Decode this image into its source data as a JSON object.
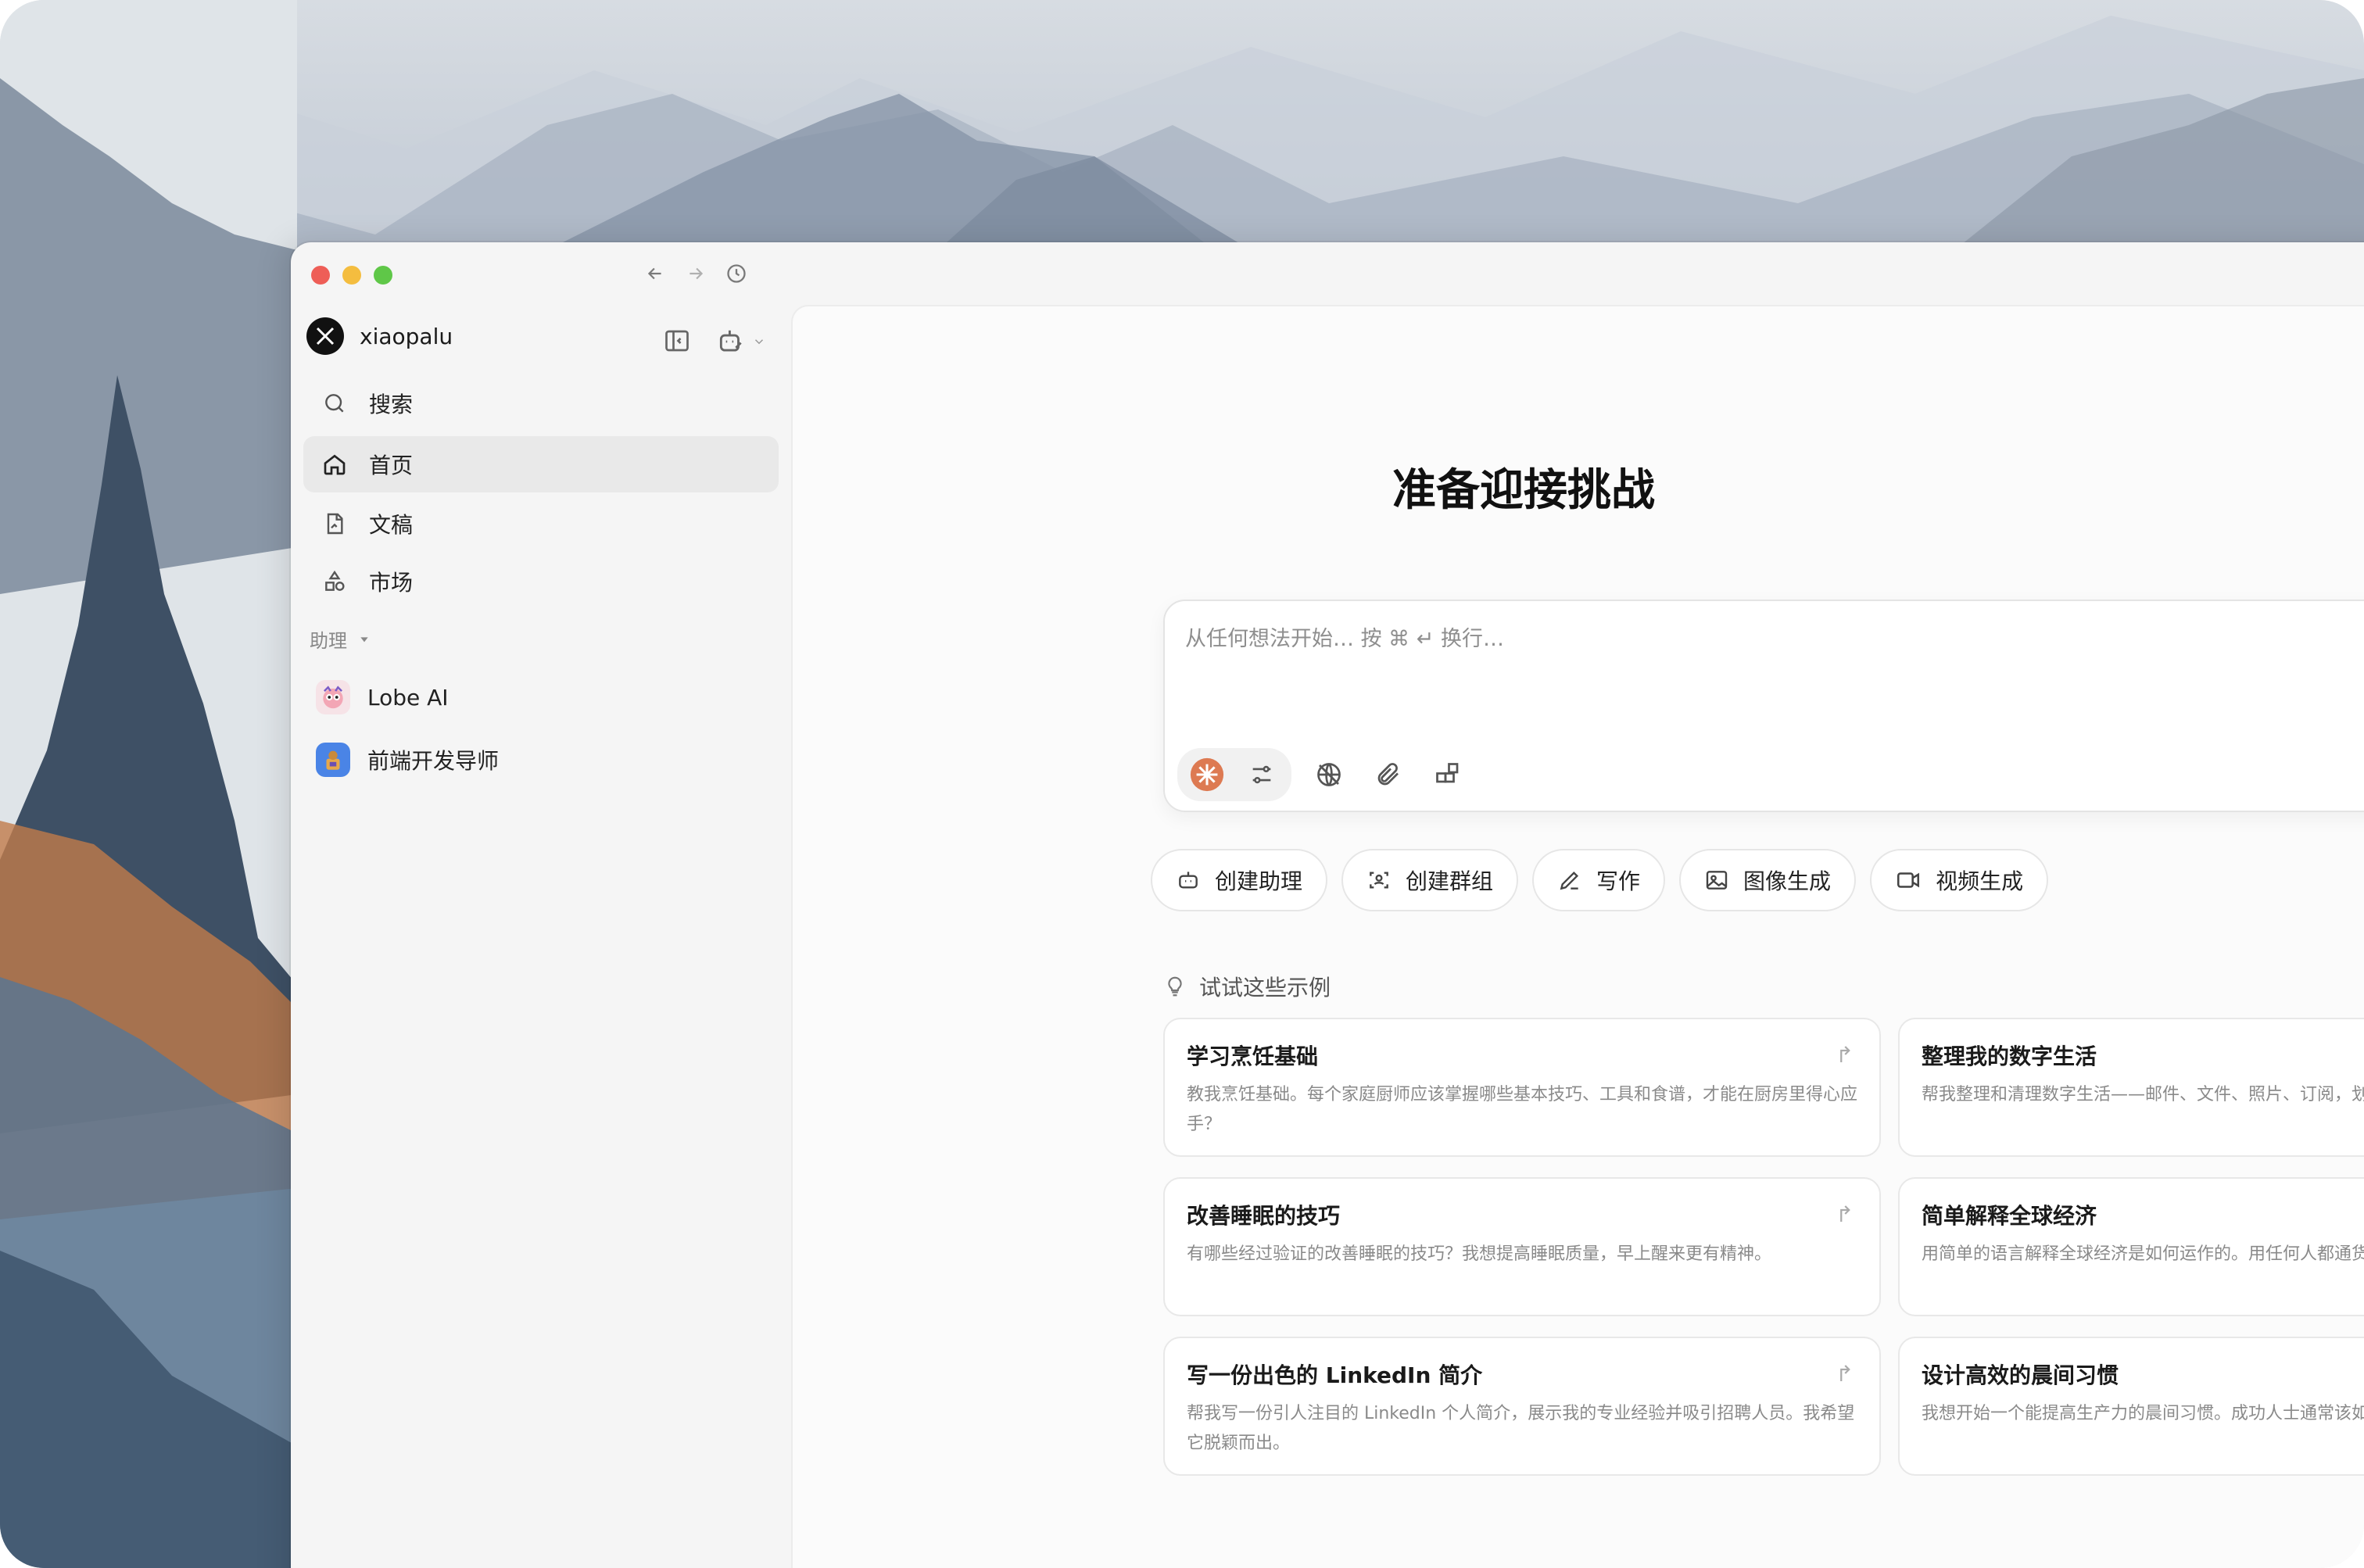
{
  "window": {
    "nav": {
      "back_icon": "arrow-left-icon",
      "forward_icon": "arrow-right-icon",
      "history_icon": "clock-icon"
    }
  },
  "sidebar": {
    "username": "xiaopalu",
    "nav_items": [
      {
        "label": "搜索",
        "icon": "search-icon"
      },
      {
        "label": "首页",
        "icon": "home-icon"
      },
      {
        "label": "文稿",
        "icon": "document-icon"
      },
      {
        "label": "市场",
        "icon": "market-icon"
      }
    ],
    "section_label": "助理",
    "assistants": [
      {
        "label": "Lobe AI",
        "icon": "lobe-avatar"
      },
      {
        "label": "前端开发导师",
        "icon": "mentor-avatar"
      }
    ]
  },
  "main": {
    "title": "准备迎接挑战",
    "input": {
      "placeholder": "从任何想法开始… 按 ⌘ ↵ 换行…"
    },
    "chips": [
      {
        "label": "创建助理",
        "icon": "robot-icon"
      },
      {
        "label": "创建群组",
        "icon": "group-icon"
      },
      {
        "label": "写作",
        "icon": "pen-icon"
      },
      {
        "label": "图像生成",
        "icon": "image-icon"
      },
      {
        "label": "视频生成",
        "icon": "video-icon"
      }
    ],
    "examples_label": "试试这些示例",
    "examples": [
      {
        "title": "学习烹饪基础",
        "desc": "教我烹饪基础。每个家庭厨师应该掌握哪些基本技巧、工具和食谱，才能在厨房里得心应手？"
      },
      {
        "title": "整理我的数字生活",
        "desc": "帮我整理和清理数字生活——邮件、文件、照片、订阅，划。"
      },
      {
        "title": "改善睡眠的技巧",
        "desc": "有哪些经过验证的改善睡眠的技巧？我想提高睡眠质量，早上醒来更有精神。"
      },
      {
        "title": "简单解释全球经济",
        "desc": "用简单的语言解释全球经济是如何运作的。用任何人都通货膨胀、利率和贸易等话题。"
      },
      {
        "title": "写一份出色的 LinkedIn 简介",
        "desc": "帮我写一份引人注目的 LinkedIn 个人简介，展示我的专业经验并吸引招聘人员。我希望它脱颖而出。"
      },
      {
        "title": "设计高效的晨间习惯",
        "desc": "我想开始一个能提高生产力的晨间习惯。成功人士通常该如何安排早晨的时间？"
      }
    ]
  },
  "colors": {
    "accent": "#e07a4f",
    "red": "#ee5e57",
    "yellow": "#f4bd3f",
    "green": "#5fc748"
  }
}
